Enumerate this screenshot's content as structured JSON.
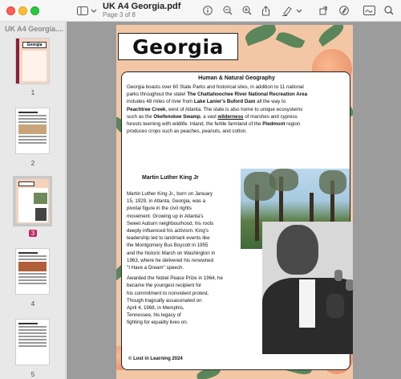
{
  "window": {
    "title": "UK A4 Georgia.pdf",
    "subtitle": "Page 3 of 8"
  },
  "toolbar": {
    "sidebar_toggle_icon": "sidebar-icon",
    "chevron_icon": "chevron-down-icon",
    "info_icon": "info-icon",
    "zoom_out_icon": "zoom-out-icon",
    "zoom_in_icon": "zoom-in-icon",
    "share_icon": "share-icon",
    "markup_icon": "highlighter-icon",
    "rotate_icon": "rotate-icon",
    "annotate_icon": "pen-circle-icon",
    "form_icon": "signature-icon",
    "search_icon": "search-icon"
  },
  "sidebar": {
    "title": "UK A4 Georgia....",
    "thumbnails": [
      {
        "label": "1"
      },
      {
        "label": "2"
      },
      {
        "label": "3",
        "selected": true
      },
      {
        "label": "4"
      },
      {
        "label": "5"
      }
    ]
  },
  "document": {
    "heading": "Georgia",
    "section1_title": "Human & Natural Geography",
    "section1_line1": "Georgia boasts over 60 State Parks and historical sites, in addition to 11 national",
    "section1_line2_a": "parks throughout the state! ",
    "section1_line2_b": "The Chattahoochee River National Recreation Area",
    "section1_line3_a": "includes 48 miles of river from ",
    "section1_line3_b": "Lake Lanier's Buford Dam",
    "section1_line3_c": " all the way to",
    "section1_line4_a": "Peachtree Creek",
    "section1_line4_b": ", west of Atlanta. The state is also home to unique ecosystems",
    "section1_line5_a": "such as the ",
    "section1_line5_b": "Okefenokee Swamp",
    "section1_line5_c": ", a vast ",
    "section1_line5_d": "wilderness",
    "section1_line5_e": " of marshes and cypress",
    "section1_line6_a": "forests teeming with wildlife. Inland, the fertile farmland of the ",
    "section1_line6_b": "Piedmont",
    "section1_line6_c": " region",
    "section1_line7": "produces crops such as peaches, peanuts, and cotton.",
    "section2_title": "Martin Luther King Jr",
    "mlk_lines": [
      "Martin Luther King Jr., born on January",
      "15, 1929, in Atlanta, Georgia, was a",
      "pivotal figure in the civil rights",
      "movement. Growing up in Atlanta's",
      "Sweet Auburn neighbourhood, his roots",
      "deeply influenced his activism. King's",
      "leadership led to landmark events like",
      "the Montgomery Bus Boycott in 1955",
      "and the historic March on Washington in",
      "1963, where he delivered his renowned",
      "\"I Have a Dream\" speech.",
      "Awarded the Nobel Peace Prize in 1964, he",
      "became the youngest recipient for",
      "his commitment to nonviolent protest.",
      "Though tragically assassinated on",
      "April 4, 1968, in Memphis,",
      "Tennessee, his legacy of",
      "fighting for equality lives on."
    ],
    "copyright": "© Lost in Learning 2024"
  }
}
